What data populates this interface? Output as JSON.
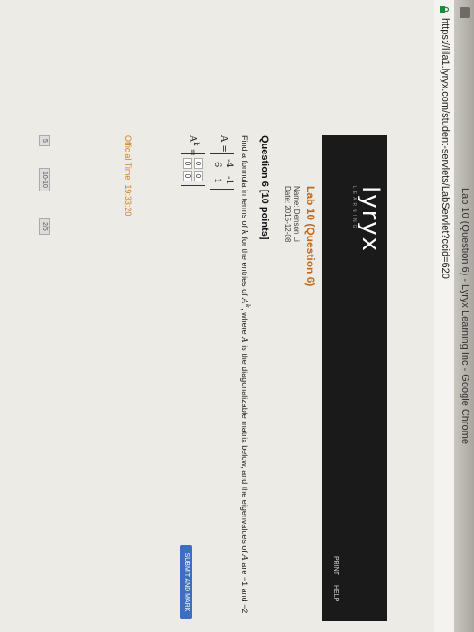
{
  "window": {
    "title": "Lab 10 (Question 6) - Lyryx Learning Inc - Google Chrome"
  },
  "browser": {
    "url": "https://lila1.lyryx.com/student-servlets/LabServlet?ccid=620"
  },
  "header": {
    "logo_text": "lyryx",
    "logo_tagline": "LEARNING",
    "print_label": "PRINT",
    "help_label": "HELP"
  },
  "lab": {
    "title": "Lab 10 (Question 6)",
    "name_line": "Name: Denson Li",
    "date_line": "Date: 2015-12-08"
  },
  "question": {
    "title": "Question 6 [10 points]",
    "text_prefix": "Find a formula in terms of",
    "var_k": "k",
    "text_mid1": "for the entries of",
    "var_ak": "A",
    "sup_k": "k",
    "text_mid2": ", where",
    "var_a": "A",
    "text_mid3": "is the diagonalizable matrix below, and the eigenvalues of",
    "var_a2": "A",
    "text_suffix": "are −1 and −2"
  },
  "matrix_a": {
    "label": "A =",
    "entries": [
      "-4",
      "-1",
      "6",
      "1"
    ]
  },
  "matrix_k": {
    "label": "A",
    "label_sup": "k",
    "label_eq": " =",
    "entries": [
      "0",
      "0",
      "0",
      "0"
    ]
  },
  "actions": {
    "submit_label": "SUBMIT AND MARK"
  },
  "status": {
    "official_time": "Official Time: 19:33:20"
  },
  "footer": {
    "chips": [
      "5",
      "10-10",
      "2/5"
    ]
  }
}
